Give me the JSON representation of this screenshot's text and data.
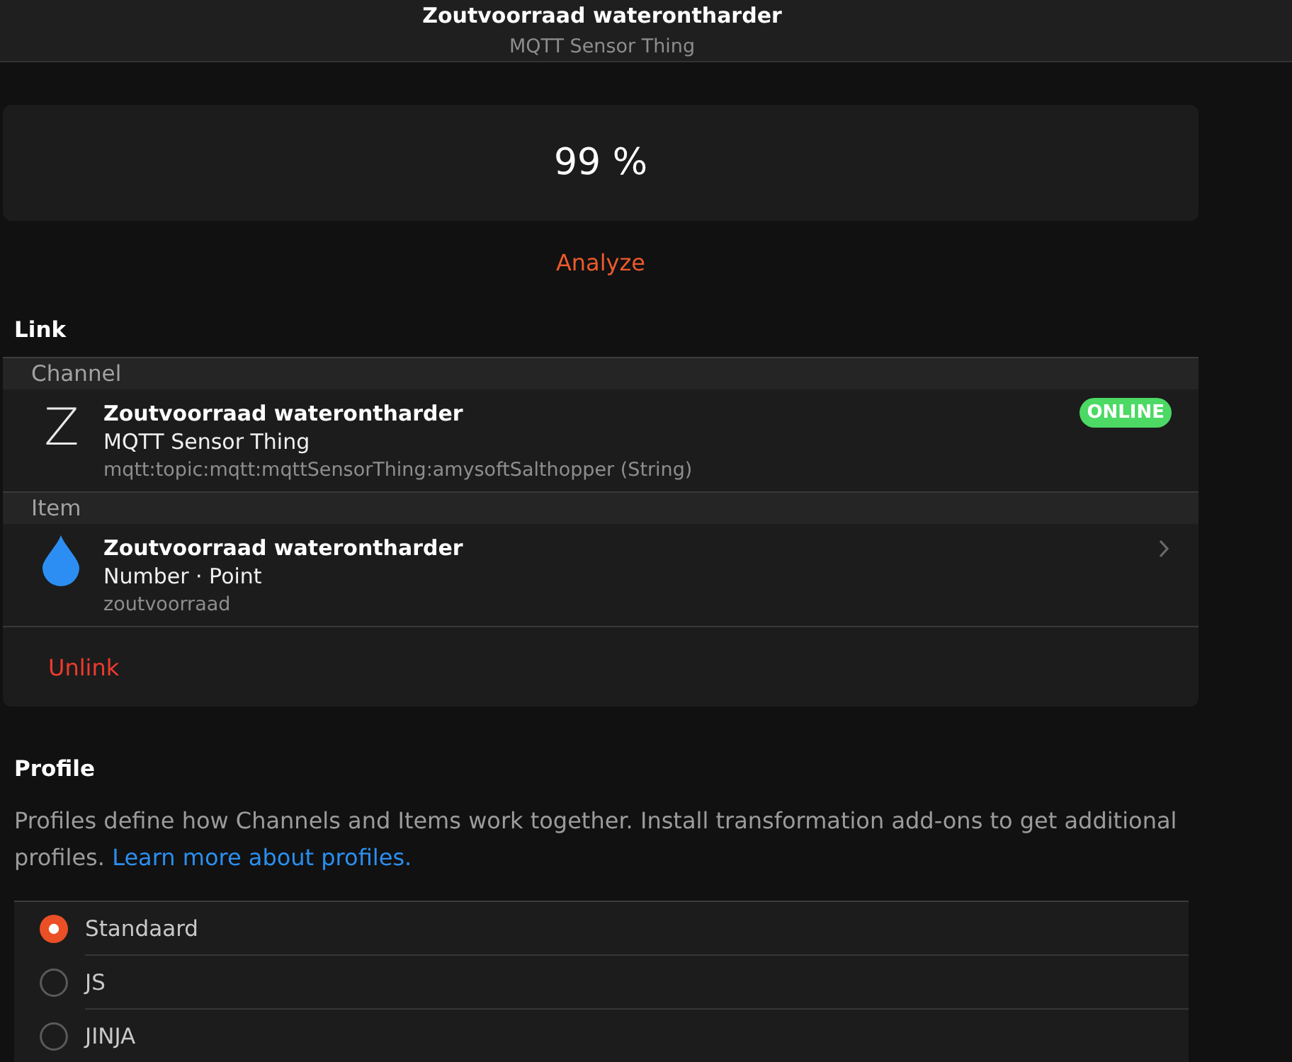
{
  "header": {
    "title": "Zoutvoorraad waterontharder",
    "subtitle": "MQTT Sensor Thing"
  },
  "state": {
    "value": "99 %"
  },
  "analyze": "Analyze",
  "link": {
    "heading": "Link",
    "sections": [
      {
        "kind": "channel",
        "label": "Channel",
        "letter": "Z",
        "title": "Zoutvoorraad waterontharder",
        "subtitle": "MQTT Sensor Thing",
        "detail": "mqtt:topic:mqtt:mqttSensorThing:amysoftSalthopper (String)",
        "badge": "ONLINE"
      },
      {
        "kind": "item",
        "label": "Item",
        "title": "Zoutvoorraad waterontharder",
        "subtitle": "Number · Point",
        "detail": "zoutvoorraad"
      }
    ],
    "unlink": "Unlink"
  },
  "profile": {
    "heading": "Profile",
    "description": "Profiles define how Channels and Items work together. Install transformation add-ons to get additional profiles.",
    "link": "Learn more about profiles.",
    "options": [
      {
        "label": "Standaard",
        "selected": true
      },
      {
        "label": "JS",
        "selected": false
      },
      {
        "label": "JINJA",
        "selected": false
      }
    ]
  }
}
